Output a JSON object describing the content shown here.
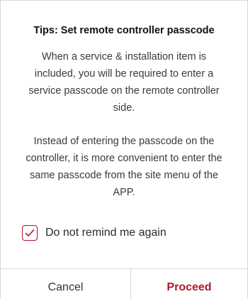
{
  "dialog": {
    "title": "Tips: Set remote controller passcode",
    "paragraph_1": "When a service & installation item is included, you will be required to enter a service passcode on the remote controller side.",
    "paragraph_2": "Instead of entering the passcode on the controller, it is more convenient to enter the same passcode from the site menu of the APP.",
    "remind_checkbox": {
      "label": "Do not remind me again",
      "checked": true,
      "icon": "check-icon"
    },
    "buttons": {
      "cancel_label": "Cancel",
      "proceed_label": "Proceed"
    }
  },
  "colors": {
    "accent": "#b3152d",
    "text": "#3a3a3a",
    "divider": "#d6d6d6"
  }
}
